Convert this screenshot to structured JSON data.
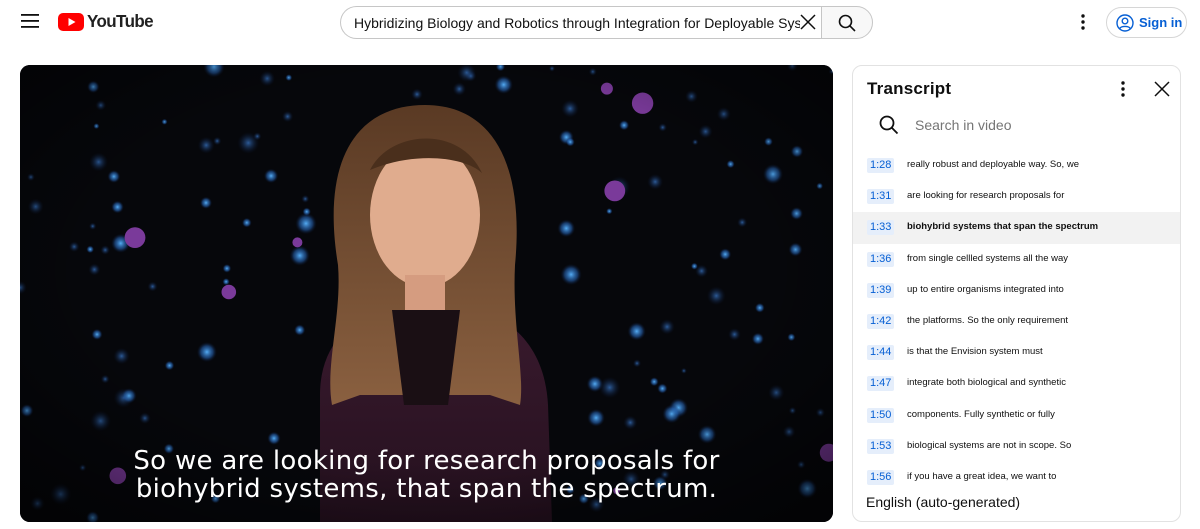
{
  "header": {
    "logo_text": "YouTube",
    "search": {
      "value": "Hybridizing Biology and Robotics through Integration for Deployable Systems"
    },
    "signin_label": "Sign in"
  },
  "video": {
    "caption_lines": [
      "So we are looking for research proposals for",
      "biohybrid systems, that span the spectrum."
    ]
  },
  "transcript": {
    "title": "Transcript",
    "search_placeholder": "Search in video",
    "segments": [
      {
        "time": "1:28",
        "text": "really robust and deployable way. So, we",
        "active": false
      },
      {
        "time": "1:31",
        "text": "are looking for research proposals for",
        "active": false
      },
      {
        "time": "1:33",
        "text": "biohybrid systems that span the spectrum",
        "active": true
      },
      {
        "time": "1:36",
        "text": "from single cellled systems all the way",
        "active": false
      },
      {
        "time": "1:39",
        "text": "up to entire organisms integrated into",
        "active": false
      },
      {
        "time": "1:42",
        "text": "the platforms. So the only requirement",
        "active": false
      },
      {
        "time": "1:44",
        "text": "is that the Envision system must",
        "active": false
      },
      {
        "time": "1:47",
        "text": "integrate both biological and synthetic",
        "active": false
      },
      {
        "time": "1:50",
        "text": "components. Fully synthetic or fully",
        "active": false
      },
      {
        "time": "1:53",
        "text": "biological systems are not in scope. So",
        "active": false
      },
      {
        "time": "1:56",
        "text": "if you have a great idea, we want to",
        "active": false
      }
    ],
    "footer_language": "English (auto-generated)"
  },
  "colors": {
    "brand_red": "#ff0000",
    "link_blue": "#065fd4",
    "timestamp_bg": "#e5eefb",
    "active_row_bg": "#f2f2f2"
  },
  "icons": {
    "menu": "hamburger-menu-icon",
    "logo": "youtube-play-icon",
    "clear": "close-icon",
    "search": "search-icon",
    "more": "more-vertical-icon",
    "account": "account-circle-icon",
    "panel_close": "close-icon"
  }
}
